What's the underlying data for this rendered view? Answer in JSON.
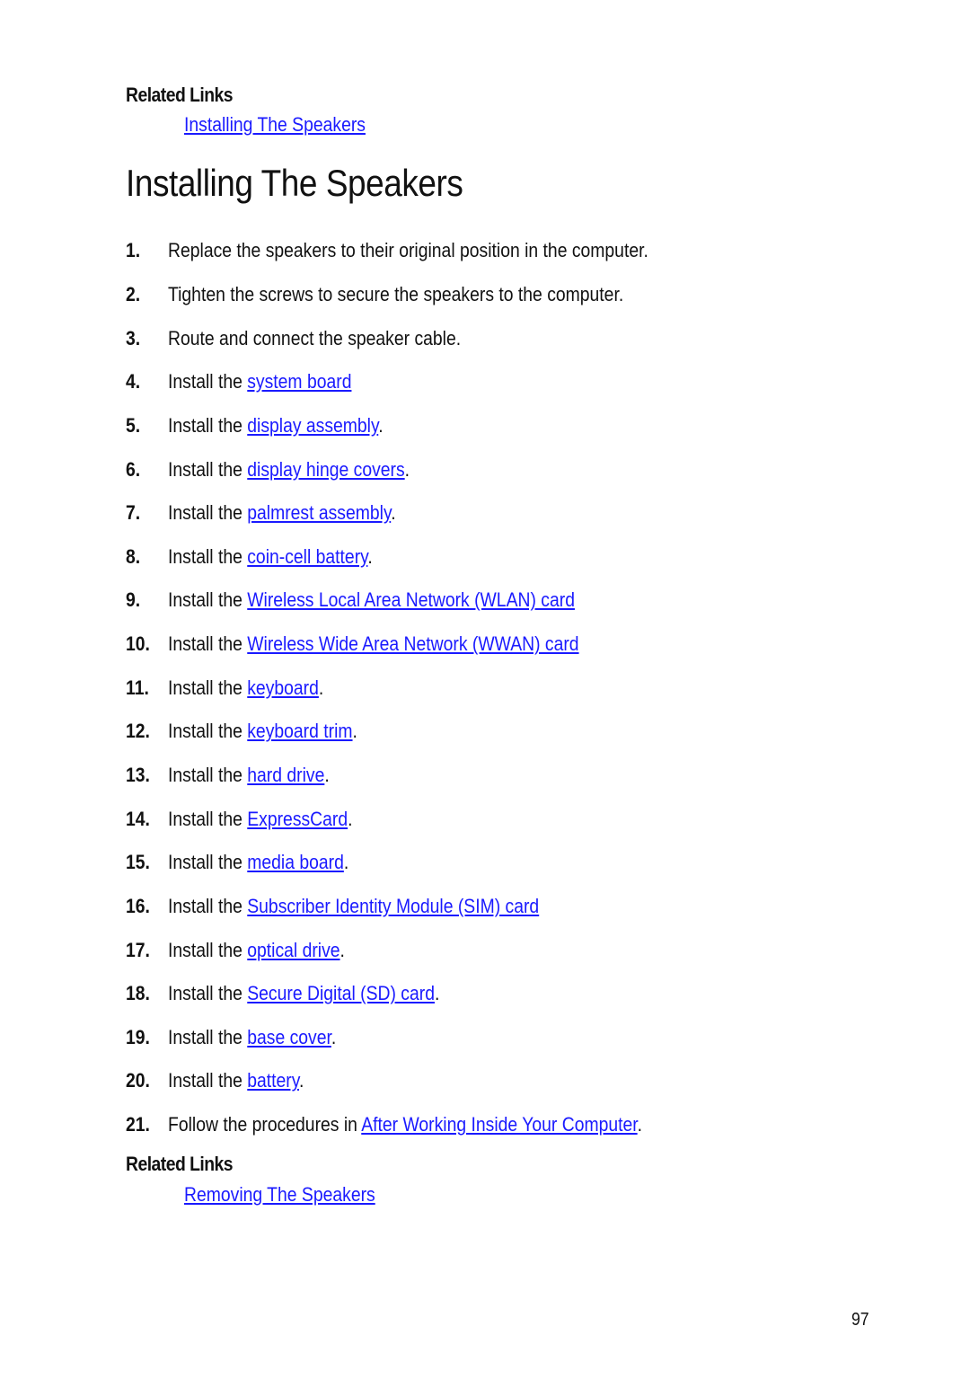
{
  "top_related": {
    "heading": "Related Links",
    "link": "Installing The Speakers"
  },
  "title": "Installing The Speakers",
  "steps": [
    {
      "num": "1.",
      "prefix": "Replace the speakers to their original position in the computer.",
      "link": "",
      "suffix": ""
    },
    {
      "num": "2.",
      "prefix": "Tighten the screws to secure the speakers to the computer.",
      "link": "",
      "suffix": ""
    },
    {
      "num": "3.",
      "prefix": "Route and connect the speaker cable.",
      "link": "",
      "suffix": ""
    },
    {
      "num": "4.",
      "prefix": "Install the ",
      "link": "system board",
      "suffix": ""
    },
    {
      "num": "5.",
      "prefix": "Install the ",
      "link": "display assembly",
      "suffix": "."
    },
    {
      "num": "6.",
      "prefix": "Install the ",
      "link": "display hinge covers",
      "suffix": "."
    },
    {
      "num": "7.",
      "prefix": "Install the ",
      "link": "palmrest assembly",
      "suffix": "."
    },
    {
      "num": "8.",
      "prefix": "Install the ",
      "link": "coin-cell battery",
      "suffix": "."
    },
    {
      "num": "9.",
      "prefix": "Install the ",
      "link": "Wireless Local Area Network (WLAN) card",
      "suffix": ""
    },
    {
      "num": "10.",
      "prefix": "Install the ",
      "link": "Wireless Wide Area Network (WWAN) card",
      "suffix": ""
    },
    {
      "num": "11.",
      "prefix": "Install the ",
      "link": "keyboard",
      "suffix": "."
    },
    {
      "num": "12.",
      "prefix": "Install the ",
      "link": "keyboard trim",
      "suffix": "."
    },
    {
      "num": "13.",
      "prefix": "Install the ",
      "link": "hard drive",
      "suffix": "."
    },
    {
      "num": "14.",
      "prefix": "Install the ",
      "link": "ExpressCard",
      "suffix": "."
    },
    {
      "num": "15.",
      "prefix": "Install the ",
      "link": "media board",
      "suffix": "."
    },
    {
      "num": "16.",
      "prefix": "Install the ",
      "link": "Subscriber Identity Module (SIM) card",
      "suffix": ""
    },
    {
      "num": "17.",
      "prefix": "Install the ",
      "link": "optical drive",
      "suffix": "."
    },
    {
      "num": "18.",
      "prefix": "Install the ",
      "link": "Secure Digital (SD) card",
      "suffix": "."
    },
    {
      "num": "19.",
      "prefix": "Install the ",
      "link": "base cover",
      "suffix": "."
    },
    {
      "num": "20.",
      "prefix": "Install the ",
      "link": "battery",
      "suffix": "."
    },
    {
      "num": "21.",
      "prefix": "Follow the procedures in ",
      "link": "After Working Inside Your Computer",
      "suffix": "."
    }
  ],
  "bottom_related": {
    "heading": "Related Links",
    "link": "Removing The Speakers"
  },
  "page_number": "97",
  "colors": {
    "link": "#1a1aff",
    "text": "#111111"
  }
}
